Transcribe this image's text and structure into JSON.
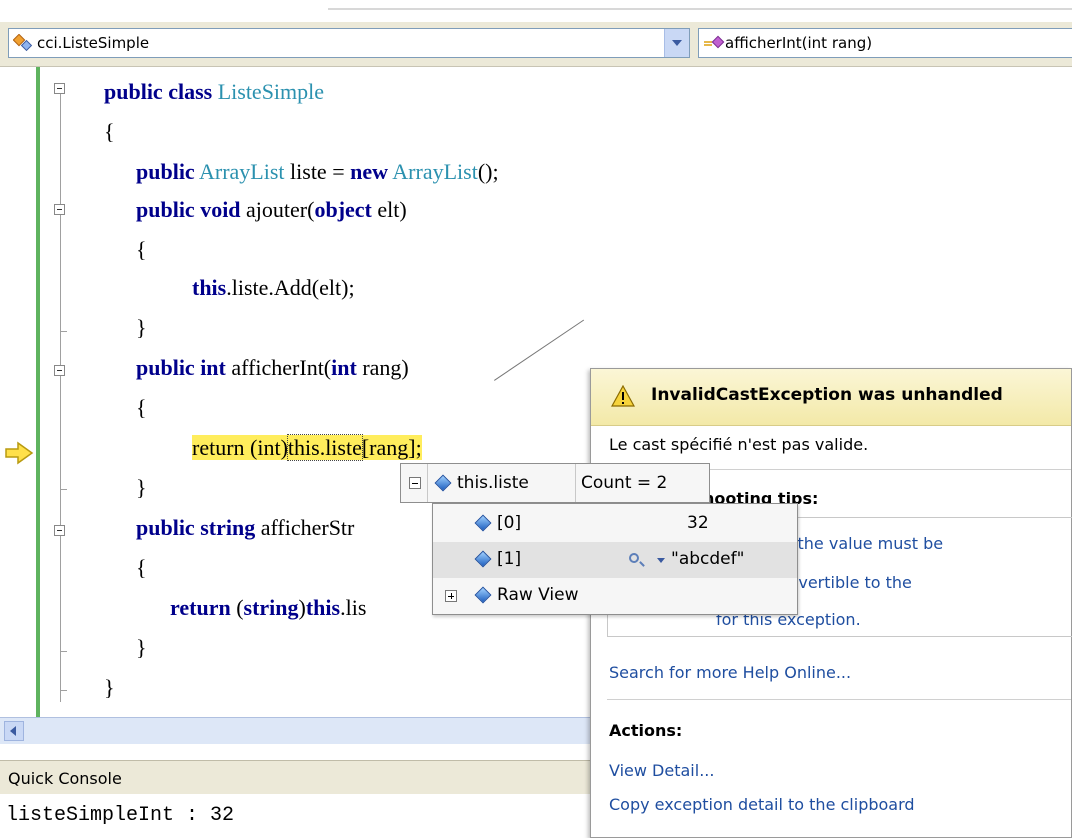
{
  "navbar": {
    "class_combo": "cci.ListeSimple",
    "member_combo": "afficherInt(int rang)"
  },
  "code": {
    "l1_kw": "public class",
    "l1_ty": "ListeSimple",
    "l2": "{",
    "l3_kw": "public",
    "l3_ty": "ArrayList",
    "l3_mid": " liste = ",
    "l3_kw2": "new",
    "l3_ty2": "ArrayList",
    "l3_end": "();",
    "l4_kw": "public void",
    "l4_mid": " ajouter(",
    "l4_kw2": "object",
    "l4_end": " elt)",
    "l5": "{",
    "l6_kw": "this",
    "l6_end": ".liste.Add(elt);",
    "l7": "}",
    "l8_kw": "public int",
    "l8_mid": " afficherInt(",
    "l8_kw2": "int",
    "l8_end": " rang)",
    "l9": "{",
    "l10_a": "return (int)",
    "l10_b": "this.liste",
    "l10_c": "[rang];",
    "l11": "}",
    "l12_kw": "public string",
    "l12_end": " afficherStr",
    "l13": "{",
    "l14_kw": "return",
    "l14_mid": " (",
    "l14_kw2": "string",
    "l14_mid2": ")",
    "l14_kw3": "this",
    "l14_end": ".lis",
    "l15": "}",
    "l16": "}"
  },
  "exception": {
    "title": "InvalidCastException was unhandled",
    "message": "Le cast spécifié n'est pas valide.",
    "tips_heading": "hooting tips:",
    "tip1": "a number, the value must be",
    "tip2": "e type is convertible to the",
    "tip3": "for this exception.",
    "search_link": "Search for more Help Online...",
    "actions_heading": "Actions:",
    "view_detail": "View Detail...",
    "copy_detail": "Copy exception detail to the clipboard"
  },
  "datatip": {
    "name": "this.liste",
    "value": "Count = 2",
    "items": [
      {
        "name": "[0]",
        "value": "32"
      },
      {
        "name": "[1]",
        "value": "\"abcdef\""
      },
      {
        "name": "Raw View",
        "value": ""
      }
    ]
  },
  "console": {
    "title": "Quick Console",
    "output": "listeSimpleInt : 32"
  },
  "colors": {
    "keyword": "#00008b",
    "type": "#2b91af",
    "highlight": "#ffed5c",
    "link": "#1f4ea0"
  }
}
